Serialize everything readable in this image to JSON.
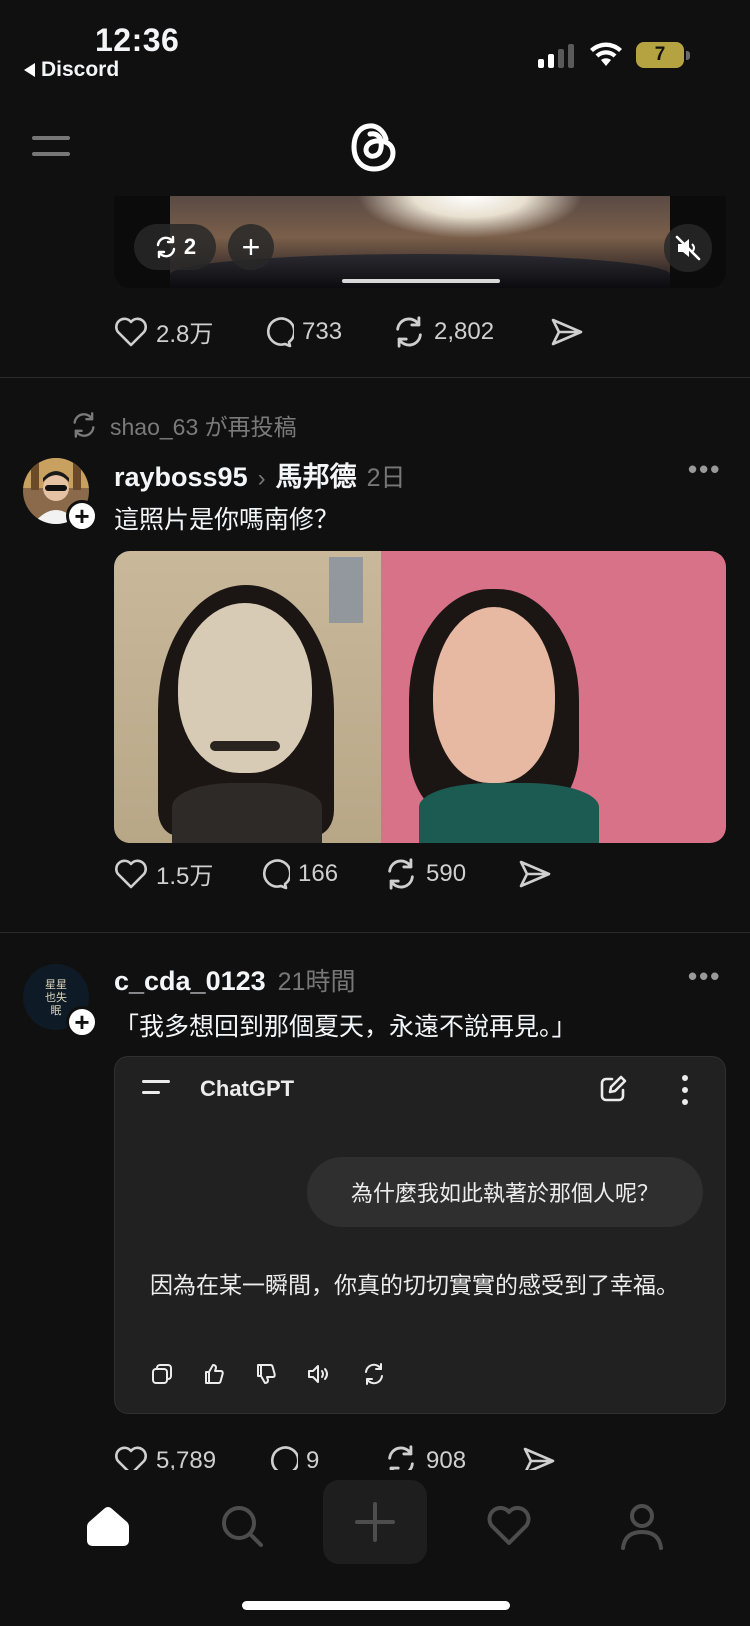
{
  "status_bar": {
    "time": "12:36",
    "back_app": "Discord",
    "battery": "7"
  },
  "post1": {
    "repost_chip_count": "2",
    "likes": "2.8万",
    "replies": "733",
    "reposts": "2,802"
  },
  "post2": {
    "repost_note": "shao_63 が再投稿",
    "username": "rayboss95",
    "reply_to": "馬邦德",
    "time": "2日",
    "text": "這照片是你嗎南修？",
    "likes": "1.5万",
    "replies": "166",
    "reposts": "590"
  },
  "post3": {
    "username": "c_cda_0123",
    "time": "21時間",
    "avatar_text": "星星也失眠",
    "text": "「我多想回到那個夏天，永遠不說再見。」",
    "card": {
      "title": "ChatGPT",
      "user_message": "為什麼我如此執著於那個人呢？",
      "assistant_message": "因為在某一瞬間，你真的切切實實的感受到了幸福。"
    },
    "likes": "5,789",
    "replies": "9",
    "reposts": "908"
  },
  "colors": {
    "background": "#101010",
    "text": "#f3f5f7",
    "muted": "#777777",
    "card": "#212121"
  },
  "tabs": [
    "home-icon",
    "search-icon",
    "create-icon",
    "activity-heart-icon",
    "profile-icon"
  ]
}
